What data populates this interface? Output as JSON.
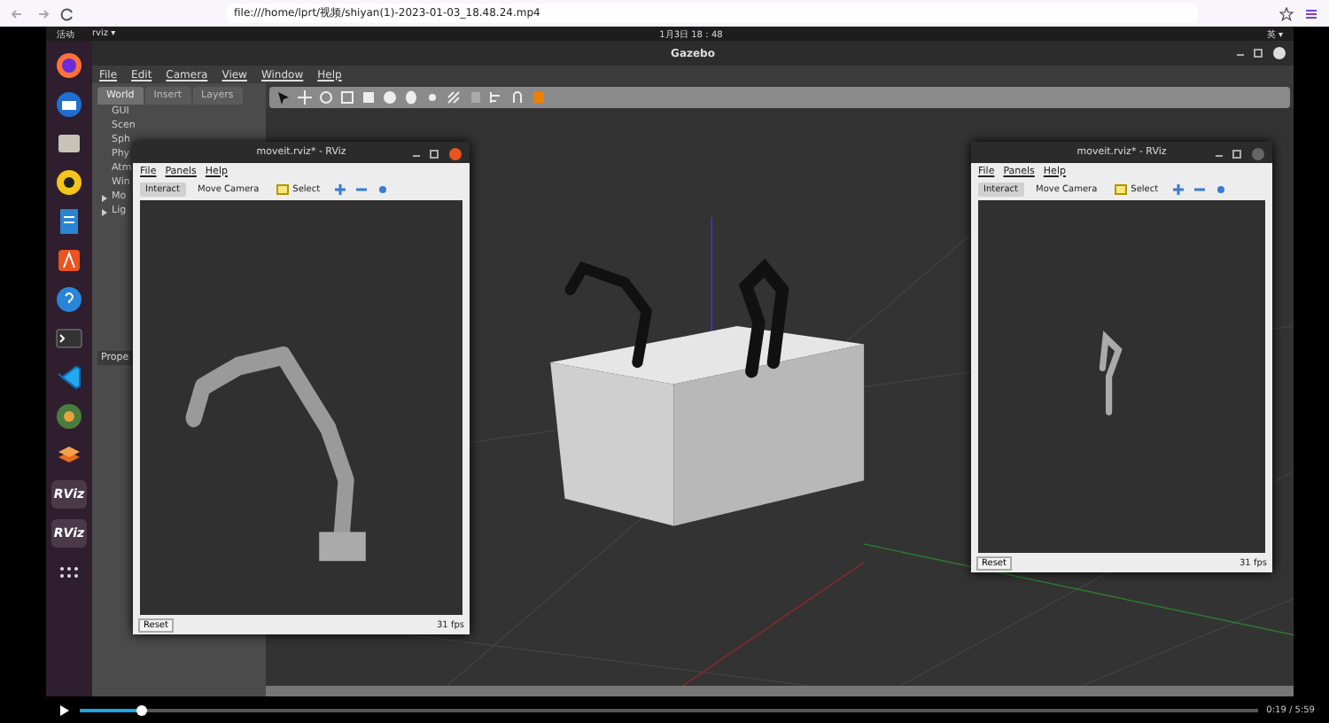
{
  "browser": {
    "url": "file:///home/lprt/视频/shiyan(1)-2023-01-03_18.48.24.mp4"
  },
  "topbar": {
    "activities": "活动",
    "app": "rviz ▾",
    "clock": "1月3日 18：48",
    "input": "英 ▾"
  },
  "dock": [
    {
      "kind": "browser"
    },
    {
      "kind": "mail"
    },
    {
      "kind": "folder"
    },
    {
      "kind": "speaker"
    },
    {
      "kind": "document"
    },
    {
      "kind": "store"
    },
    {
      "kind": "help"
    },
    {
      "kind": "terminal"
    },
    {
      "kind": "code"
    },
    {
      "kind": "disc"
    },
    {
      "kind": "layers"
    },
    {
      "kind": "text",
      "label": "RViz"
    },
    {
      "kind": "text",
      "label": "RViz"
    },
    {
      "kind": "grid"
    }
  ],
  "gazebo": {
    "title": "Gazebo",
    "menu": [
      "File",
      "Edit",
      "Camera",
      "View",
      "Window",
      "Help"
    ],
    "tabs": [
      {
        "label": "World",
        "selected": true
      },
      {
        "label": "Insert",
        "selected": false
      },
      {
        "label": "Layers",
        "selected": false
      }
    ],
    "tree": [
      {
        "label": "GUI",
        "expandable": false
      },
      {
        "label": "Scen",
        "expandable": false
      },
      {
        "label": "Sph",
        "expandable": false
      },
      {
        "label": "Phy",
        "expandable": false
      },
      {
        "label": "Atm",
        "expandable": false
      },
      {
        "label": "Win",
        "expandable": false
      },
      {
        "label": "Mo",
        "expandable": true
      },
      {
        "label": "Lig",
        "expandable": true
      }
    ],
    "properties": "Prope"
  },
  "rviz_windows": [
    {
      "title": "moveit.rviz* - RViz",
      "menu": [
        "File",
        "Panels",
        "Help"
      ],
      "tools": [
        {
          "label": "Interact",
          "selected": true
        },
        {
          "label": "Move Camera",
          "selected": false
        },
        {
          "label": "Select",
          "selected": false
        }
      ],
      "reset": "Reset",
      "fps": "31 fps",
      "kind": "near"
    },
    {
      "title": "moveit.rviz* - RViz",
      "menu": [
        "File",
        "Panels",
        "Help"
      ],
      "tools": [
        {
          "label": "Interact",
          "selected": true
        },
        {
          "label": "Move Camera",
          "selected": false
        },
        {
          "label": "Select",
          "selected": false
        }
      ],
      "reset": "Reset",
      "fps": "31 fps",
      "kind": "far"
    }
  ],
  "player": {
    "level": 0.053,
    "time": "0:19 / 5:59"
  }
}
